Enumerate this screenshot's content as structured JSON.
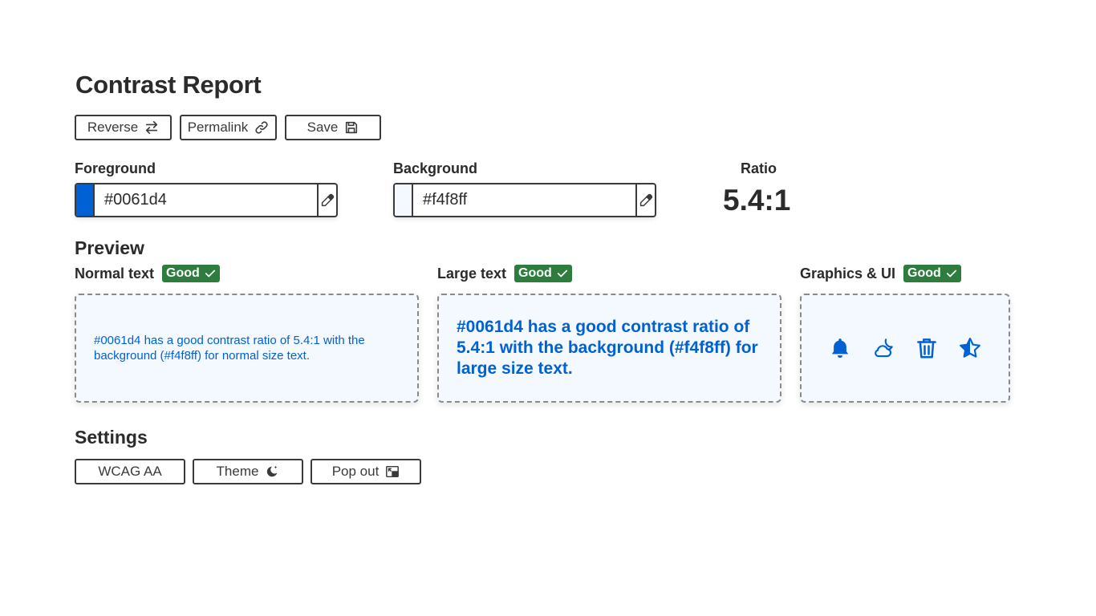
{
  "header": {
    "title": "Contrast Report"
  },
  "toolbar": {
    "reverse_label": "Reverse",
    "permalink_label": "Permalink",
    "save_label": "Save"
  },
  "foreground": {
    "label": "Foreground",
    "value": "#0061d4",
    "color": "#0061d4"
  },
  "background": {
    "label": "Background",
    "value": "#f4f8ff",
    "color": "#f4f8ff"
  },
  "ratio": {
    "label": "Ratio",
    "value": "5.4:1"
  },
  "preview": {
    "title": "Preview",
    "normal": {
      "label": "Normal text",
      "badge": "Good",
      "text": "#0061d4 has a good contrast ratio of 5.4:1 with the background (#f4f8ff) for normal size text."
    },
    "large": {
      "label": "Large text",
      "badge": "Good",
      "text": "#0061d4 has a good contrast ratio of 5.4:1 with the background (#f4f8ff) for large size text."
    },
    "graphics": {
      "label": "Graphics & UI",
      "badge": "Good",
      "icons": [
        "bell-icon",
        "cloud-moon-icon",
        "trash-icon",
        "half-star-icon"
      ]
    }
  },
  "settings": {
    "title": "Settings",
    "wcag_label": "WCAG AA",
    "theme_label": "Theme",
    "popout_label": "Pop out"
  },
  "colors": {
    "good_badge": "#2e7d3e",
    "accent": "#0061d4",
    "border": "#3a3a3a"
  }
}
